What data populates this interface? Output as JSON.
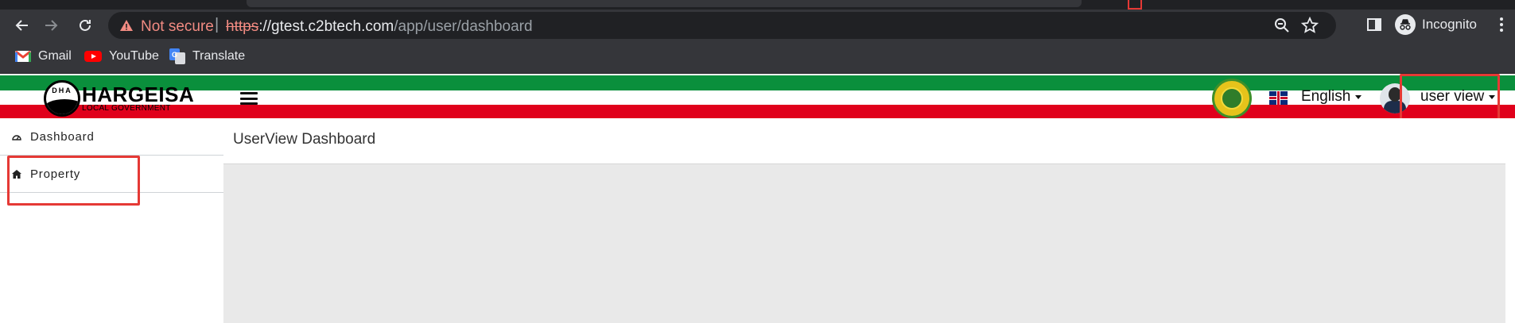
{
  "browser": {
    "security_label": "Not secure",
    "separator": "|",
    "url_scheme": "https",
    "url_sep": "://",
    "url_host": "gtest.c2btech.com",
    "url_path": "/app/user/dashboard",
    "incognito_label": "Incognito",
    "bookmarks": [
      {
        "label": "Gmail",
        "icon": "gmail-icon"
      },
      {
        "label": "YouTube",
        "icon": "youtube-icon"
      },
      {
        "label": "Translate",
        "icon": "translate-icon"
      }
    ]
  },
  "header": {
    "logo_title": "HARGEISA",
    "logo_subtitle": "LOCAL GOVERNMENT",
    "logo_emblem_letters": "DHA",
    "language": "English",
    "user_name": "user view"
  },
  "sidebar": {
    "items": [
      {
        "label": "Dashboard",
        "icon": "dashboard-icon"
      },
      {
        "label": "Property",
        "icon": "home-icon"
      }
    ]
  },
  "main": {
    "title": "UserView Dashboard"
  },
  "colors": {
    "stripe_green": "#0a8f3c",
    "stripe_red": "#e0001b",
    "highlight": "#e53935"
  }
}
